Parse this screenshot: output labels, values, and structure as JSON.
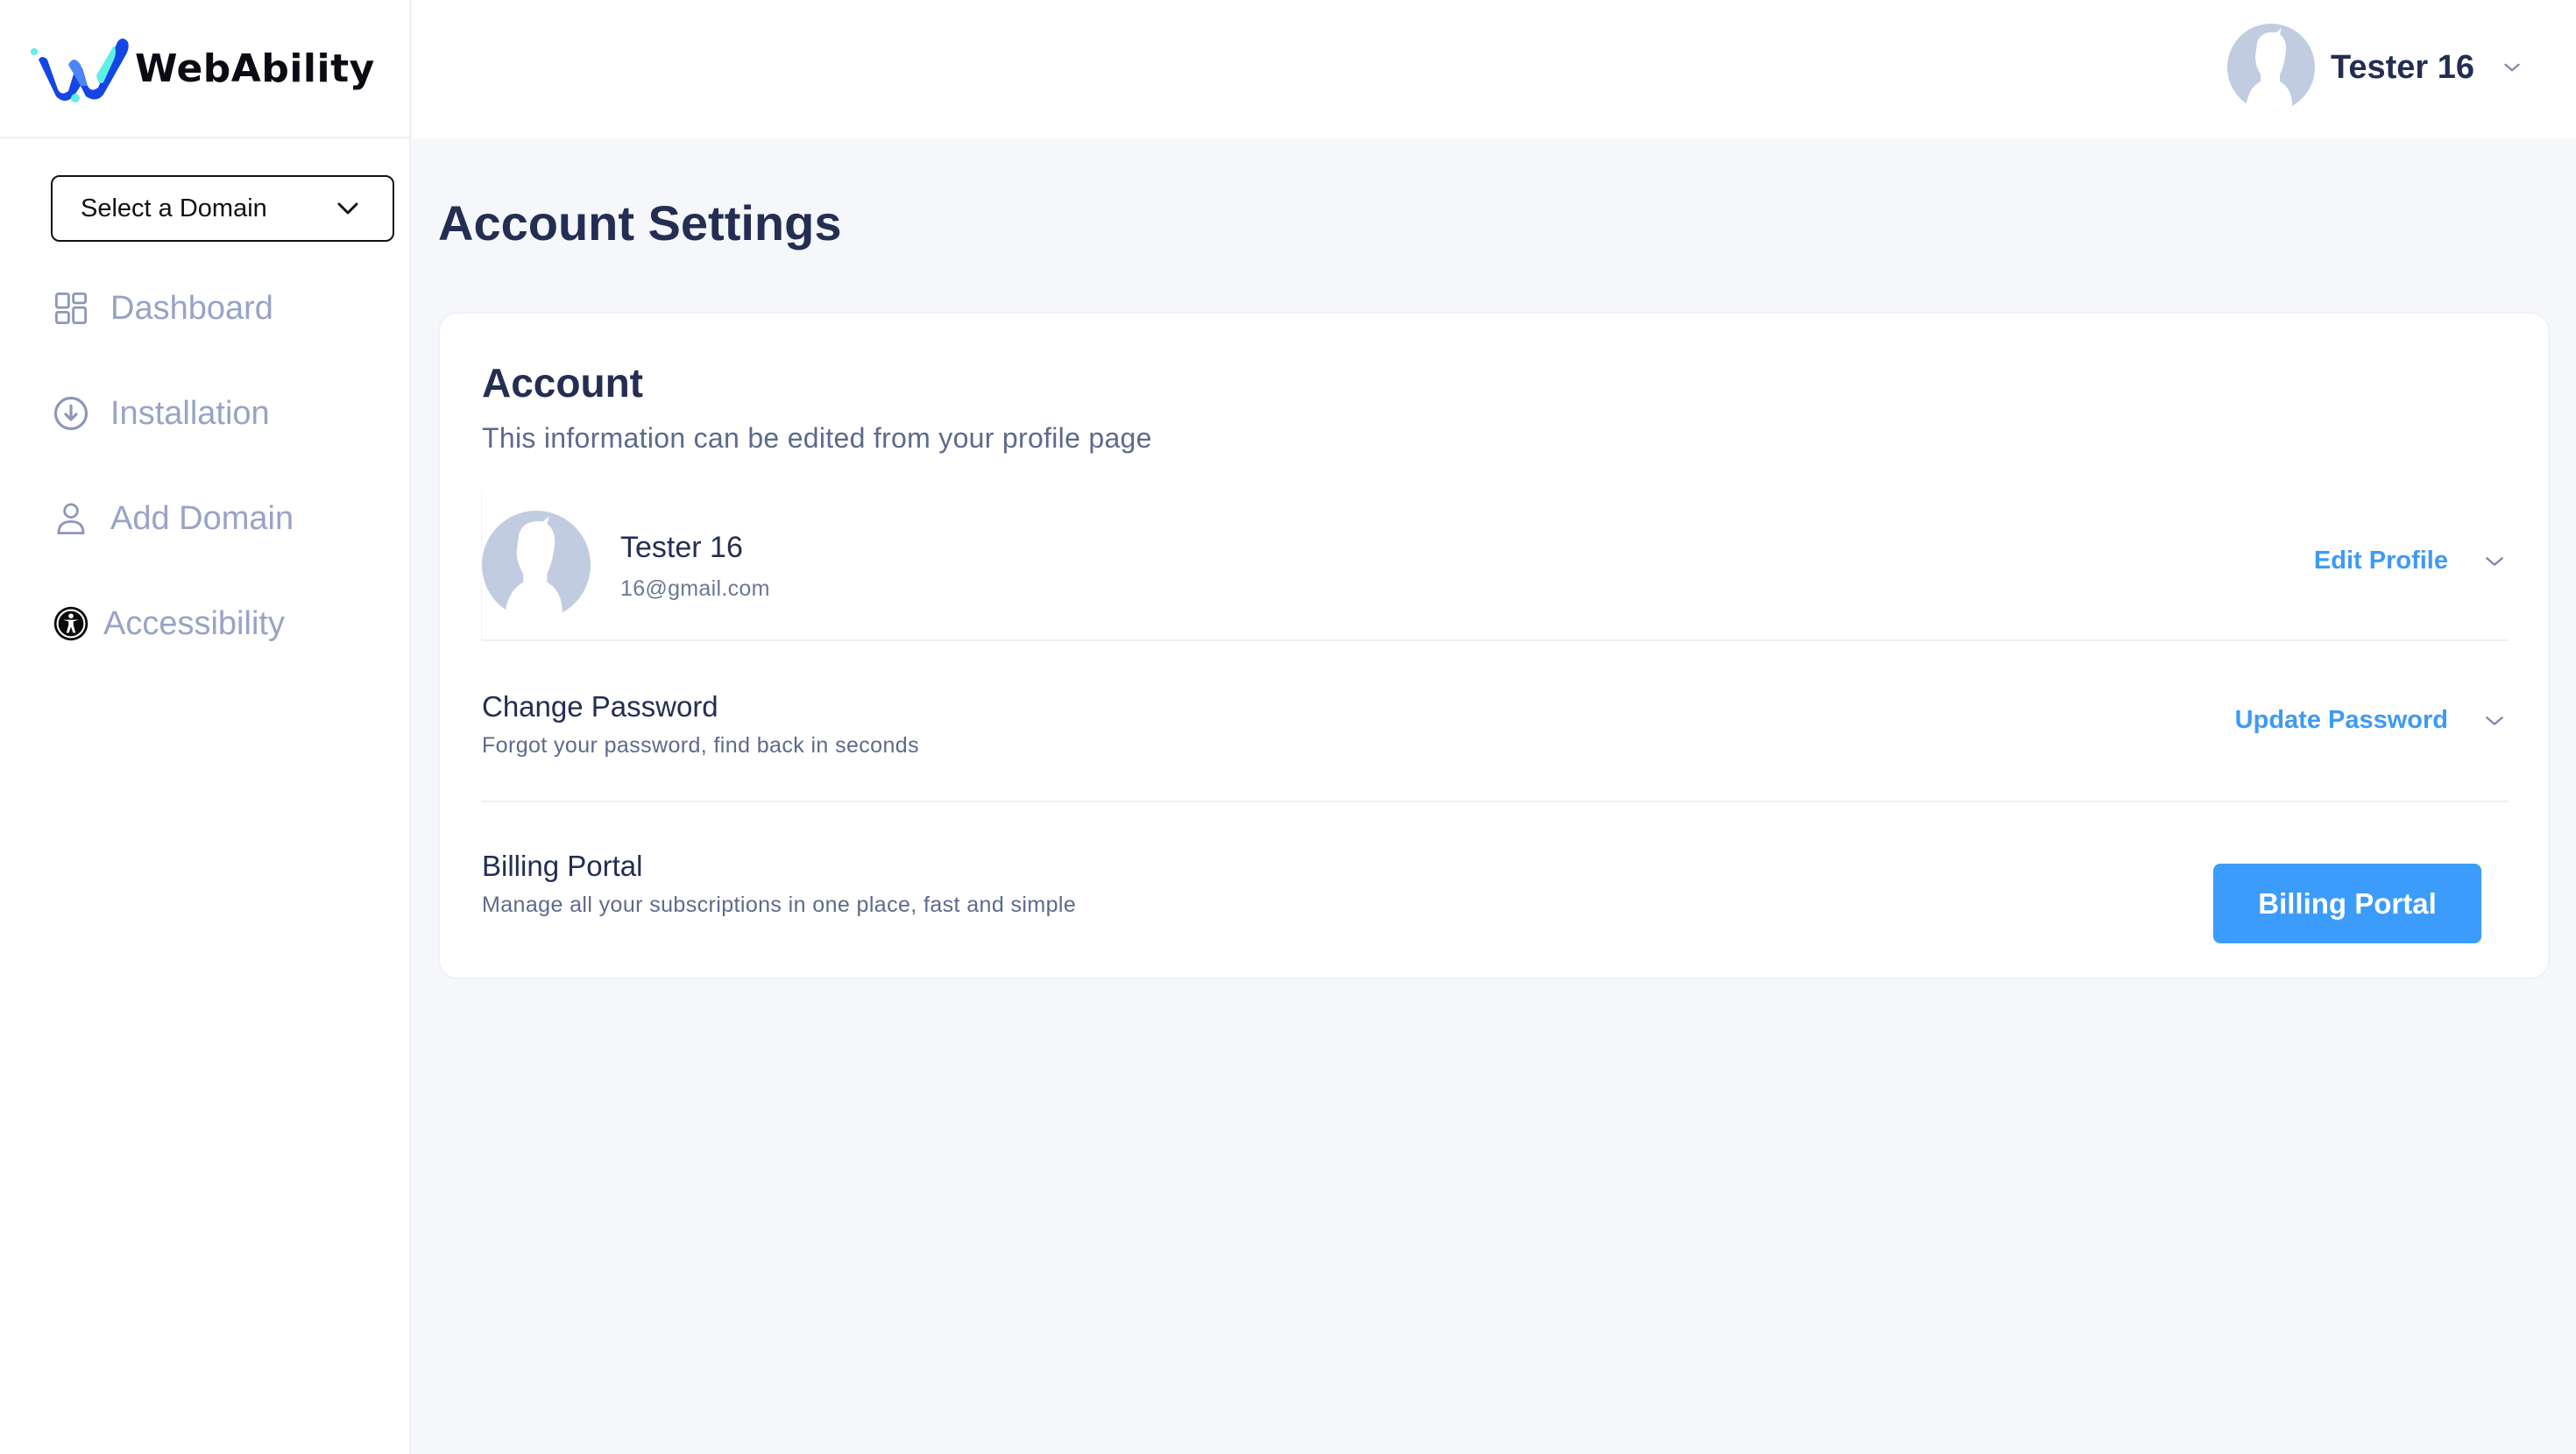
{
  "brand": {
    "name": "WebAbility"
  },
  "sidebar": {
    "domain_select": {
      "placeholder": "Select a Domain"
    },
    "items": [
      {
        "label": "Dashboard",
        "icon": "dashboard-grid-icon"
      },
      {
        "label": "Installation",
        "icon": "download-circle-icon"
      },
      {
        "label": "Add Domain",
        "icon": "user-icon"
      },
      {
        "label": "Accessibility",
        "icon": "accessibility-icon"
      }
    ]
  },
  "header": {
    "user_name": "Tester 16"
  },
  "main": {
    "page_title": "Account Settings",
    "card": {
      "title": "Account",
      "subtitle": "This information can be edited from your profile page",
      "profile": {
        "name": "Tester 16",
        "email": "16@gmail.com",
        "action_label": "Edit Profile"
      },
      "password": {
        "title": "Change Password",
        "subtitle": "Forgot your password, find back in seconds",
        "action_label": "Update Password"
      },
      "billing": {
        "title": "Billing Portal",
        "subtitle": "Manage all your subscriptions in one place, fast and simple",
        "button_label": "Billing Portal"
      }
    }
  },
  "colors": {
    "accent": "#3b9cfb",
    "text_primary": "#232e52",
    "nav_text": "#98a3c5",
    "background": "#f5f7fb"
  }
}
